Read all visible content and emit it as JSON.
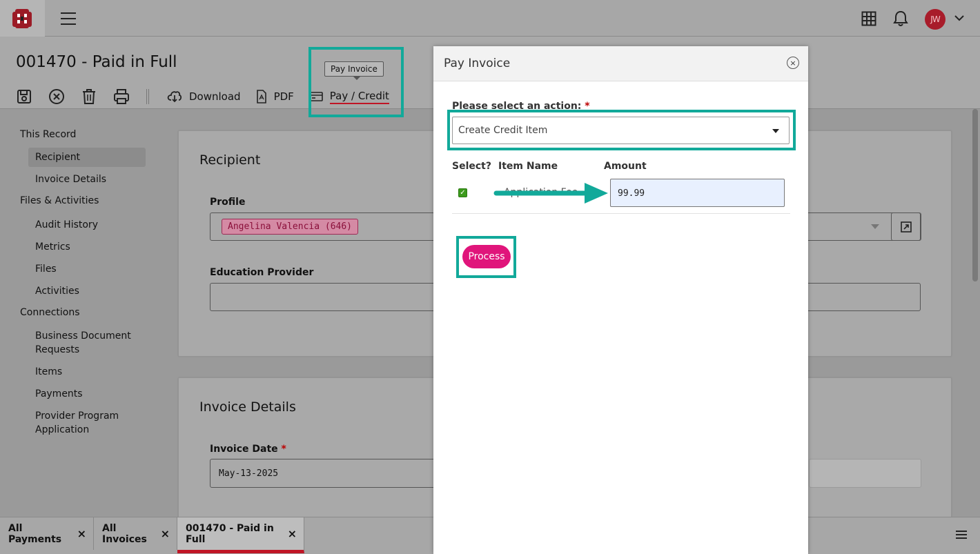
{
  "topbar": {
    "avatar_initials": "JW",
    "icons": [
      "logo-icon",
      "hamburger-menu-icon",
      "apps-grid-icon",
      "bell-icon",
      "chevron-down-icon"
    ]
  },
  "page": {
    "title": "001470 - Paid in Full",
    "tooltip": "Pay Invoice",
    "toolbar": {
      "download_label": "Download",
      "pdf_label": "PDF",
      "pay_credit_label": "Pay / Credit"
    }
  },
  "sidebar": {
    "groups": [
      {
        "label": "This Record",
        "items": [
          "Recipient",
          "Invoice Details"
        ]
      },
      {
        "label": "Files & Activities",
        "items": [
          "Audit History",
          "Metrics",
          "Files",
          "Activities"
        ]
      },
      {
        "label": "Connections",
        "items": [
          "Business Document Requests",
          "Items",
          "Payments",
          "Provider Program Application"
        ]
      }
    ],
    "active_item": "Recipient"
  },
  "recipient_card": {
    "title": "Recipient",
    "profile_label": "Profile",
    "profile_value": "Angelina Valencia (646)",
    "education_provider_label": "Education Provider",
    "education_provider_value": ""
  },
  "invoice_card": {
    "title": "Invoice Details",
    "invoice_date_label": "Invoice Date",
    "required_mark": "*",
    "invoice_date_value": "May-13-2025"
  },
  "tabs": [
    {
      "label": "All Payments",
      "close": "×",
      "active": false
    },
    {
      "label": "All Invoices",
      "close": "×",
      "active": false
    },
    {
      "label": "001470 - Paid in Full",
      "close": "×",
      "active": true
    }
  ],
  "modal": {
    "title": "Pay Invoice",
    "close_glyph": "×",
    "action_label": "Please select an action:",
    "required_mark": "*",
    "action_value": "Create Credit Item",
    "columns": {
      "select": "Select?",
      "item_name": "Item Name",
      "amount": "Amount"
    },
    "rows": [
      {
        "selected": true,
        "item_name": "Application Fee",
        "amount": "99.99"
      }
    ],
    "process_label": "Process"
  },
  "colors": {
    "highlight": "#12a99a",
    "accent_red": "#c01525",
    "process_button": "#e0157b",
    "checkbox_green": "#3c9a1c"
  }
}
